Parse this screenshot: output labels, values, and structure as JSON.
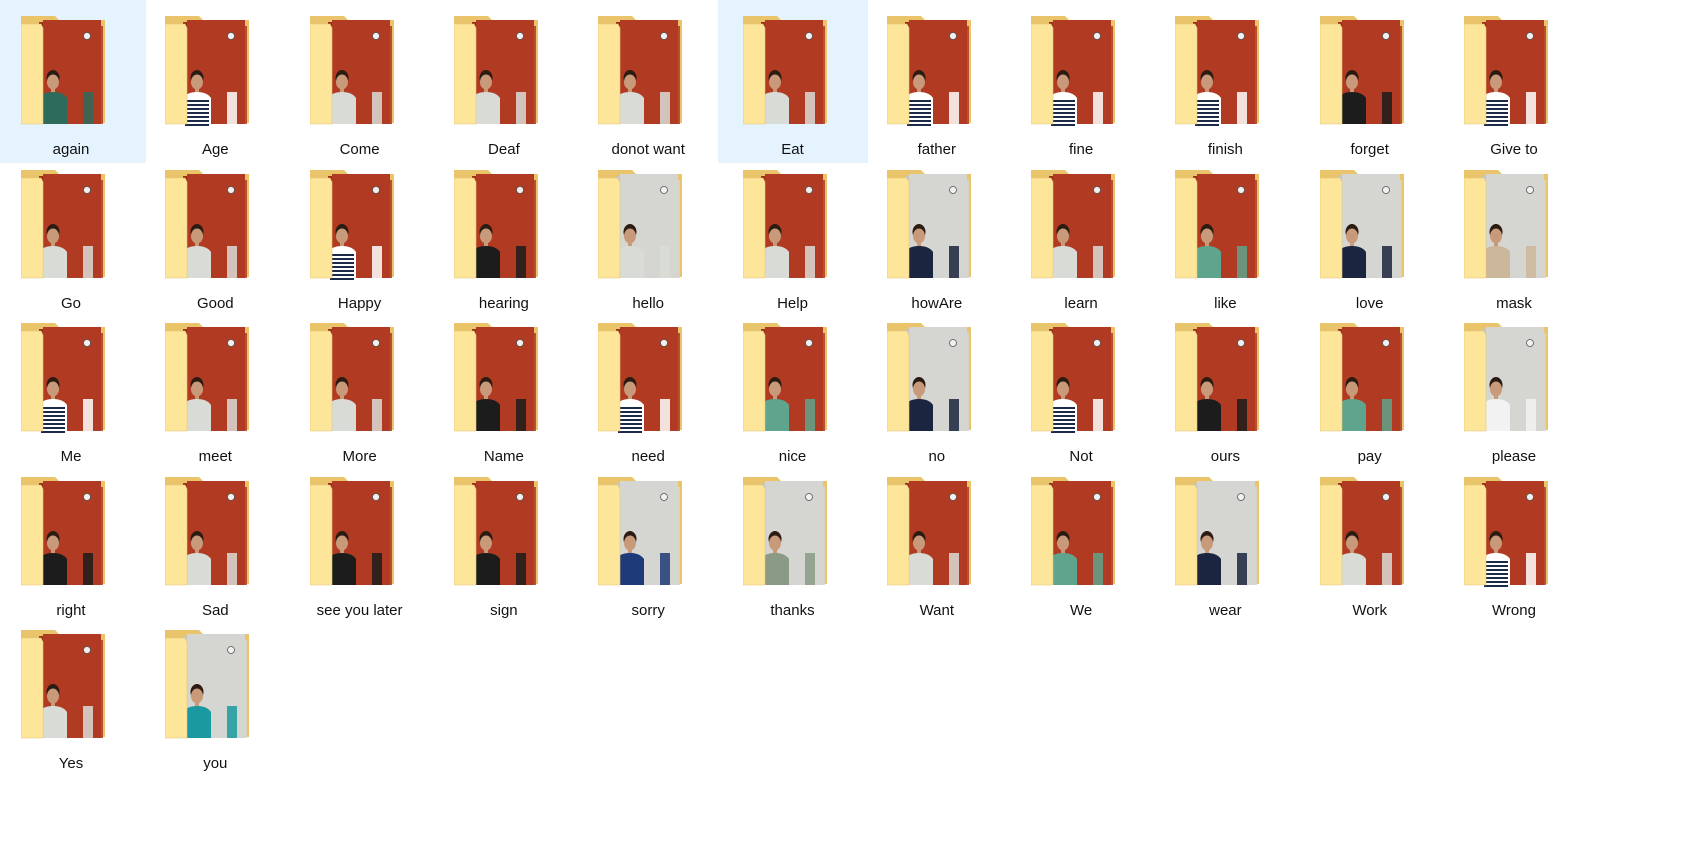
{
  "window": {
    "view": "large-icons"
  },
  "colors": {
    "selection": "#e5f3ff",
    "folder_back": "#e9c46a",
    "folder_front": "#fde59a",
    "wall_red": "#b13b22",
    "wall_grey": "#d5d6d1",
    "text": "#111111"
  },
  "folders": [
    {
      "label": "again",
      "bg": "red",
      "shirt": "#2d6b5d",
      "selected": false
    },
    {
      "label": "Age",
      "bg": "red",
      "shirt": "stripe",
      "selected": false
    },
    {
      "label": "Come",
      "bg": "red",
      "shirt": "#d9dcd6",
      "selected": false
    },
    {
      "label": "Deaf",
      "bg": "red",
      "shirt": "#d9dcd6",
      "selected": false
    },
    {
      "label": "donot want",
      "bg": "red",
      "shirt": "#d9dcd6",
      "selected": false
    },
    {
      "label": "Eat",
      "bg": "red",
      "shirt": "#d9dcd6",
      "selected": true
    },
    {
      "label": "father",
      "bg": "red",
      "shirt": "stripe",
      "selected": false
    },
    {
      "label": "fine",
      "bg": "red",
      "shirt": "stripe",
      "selected": false
    },
    {
      "label": "finish",
      "bg": "red",
      "shirt": "stripe",
      "selected": false
    },
    {
      "label": "forget",
      "bg": "red",
      "shirt": "#1c1c1c",
      "selected": false
    },
    {
      "label": "Give to",
      "bg": "red",
      "shirt": "stripe",
      "selected": false
    },
    {
      "label": "Go",
      "bg": "red",
      "shirt": "#d9dcd6",
      "selected": false
    },
    {
      "label": "Good",
      "bg": "red",
      "shirt": "#d9dcd6",
      "selected": false
    },
    {
      "label": "Happy",
      "bg": "red",
      "shirt": "stripe",
      "selected": false
    },
    {
      "label": "hearing",
      "bg": "red",
      "shirt": "#1c1c1c",
      "selected": false
    },
    {
      "label": "hello",
      "bg": "grey",
      "shirt": "#d9dcd6",
      "selected": false
    },
    {
      "label": "Help",
      "bg": "red",
      "shirt": "#d9dcd6",
      "selected": false
    },
    {
      "label": "howAre",
      "bg": "grey",
      "shirt": "#1b2540",
      "selected": false
    },
    {
      "label": "learn",
      "bg": "red",
      "shirt": "#d9dcd6",
      "selected": false
    },
    {
      "label": "like",
      "bg": "red",
      "shirt": "#5fa48c",
      "selected": false
    },
    {
      "label": "love",
      "bg": "grey",
      "shirt": "#1b2540",
      "selected": false
    },
    {
      "label": "mask",
      "bg": "grey",
      "shirt": "#cbb79a",
      "selected": false
    },
    {
      "label": "Me",
      "bg": "red",
      "shirt": "stripe",
      "selected": false
    },
    {
      "label": "meet",
      "bg": "red",
      "shirt": "#d9dcd6",
      "selected": false
    },
    {
      "label": "More",
      "bg": "red",
      "shirt": "#d9dcd6",
      "selected": false
    },
    {
      "label": "Name",
      "bg": "red",
      "shirt": "#1c1c1c",
      "selected": false
    },
    {
      "label": "need",
      "bg": "red",
      "shirt": "stripe",
      "selected": false
    },
    {
      "label": "nice",
      "bg": "red",
      "shirt": "#5fa48c",
      "selected": false
    },
    {
      "label": "no",
      "bg": "grey",
      "shirt": "#1b2540",
      "selected": false
    },
    {
      "label": "Not",
      "bg": "red",
      "shirt": "stripe",
      "selected": false
    },
    {
      "label": "ours",
      "bg": "red",
      "shirt": "#1c1c1c",
      "selected": false
    },
    {
      "label": "pay",
      "bg": "red",
      "shirt": "#5fa48c",
      "selected": false
    },
    {
      "label": "please",
      "bg": "grey",
      "shirt": "#f2f2f2",
      "selected": false
    },
    {
      "label": "right",
      "bg": "red",
      "shirt": "#1c1c1c",
      "selected": false
    },
    {
      "label": "Sad",
      "bg": "red",
      "shirt": "#d9dcd6",
      "selected": false
    },
    {
      "label": "see you later",
      "bg": "red",
      "shirt": "#1c1c1c",
      "selected": false
    },
    {
      "label": "sign",
      "bg": "red",
      "shirt": "#1c1c1c",
      "selected": false
    },
    {
      "label": "sorry",
      "bg": "grey",
      "shirt": "#1e3a78",
      "selected": false
    },
    {
      "label": "thanks",
      "bg": "grey",
      "shirt": "#8a9a86",
      "selected": false
    },
    {
      "label": "Want",
      "bg": "red",
      "shirt": "#d9dcd6",
      "selected": false
    },
    {
      "label": "We",
      "bg": "red",
      "shirt": "#5fa48c",
      "selected": false
    },
    {
      "label": "wear",
      "bg": "grey",
      "shirt": "#1b2540",
      "selected": false
    },
    {
      "label": "Work",
      "bg": "red",
      "shirt": "#d9dcd6",
      "selected": false
    },
    {
      "label": "Wrong",
      "bg": "red",
      "shirt": "stripe",
      "selected": false
    },
    {
      "label": "Yes",
      "bg": "red",
      "shirt": "#d9dcd6",
      "selected": false
    },
    {
      "label": "you",
      "bg": "grey",
      "shirt": "#1a9aa0",
      "selected": false
    }
  ]
}
